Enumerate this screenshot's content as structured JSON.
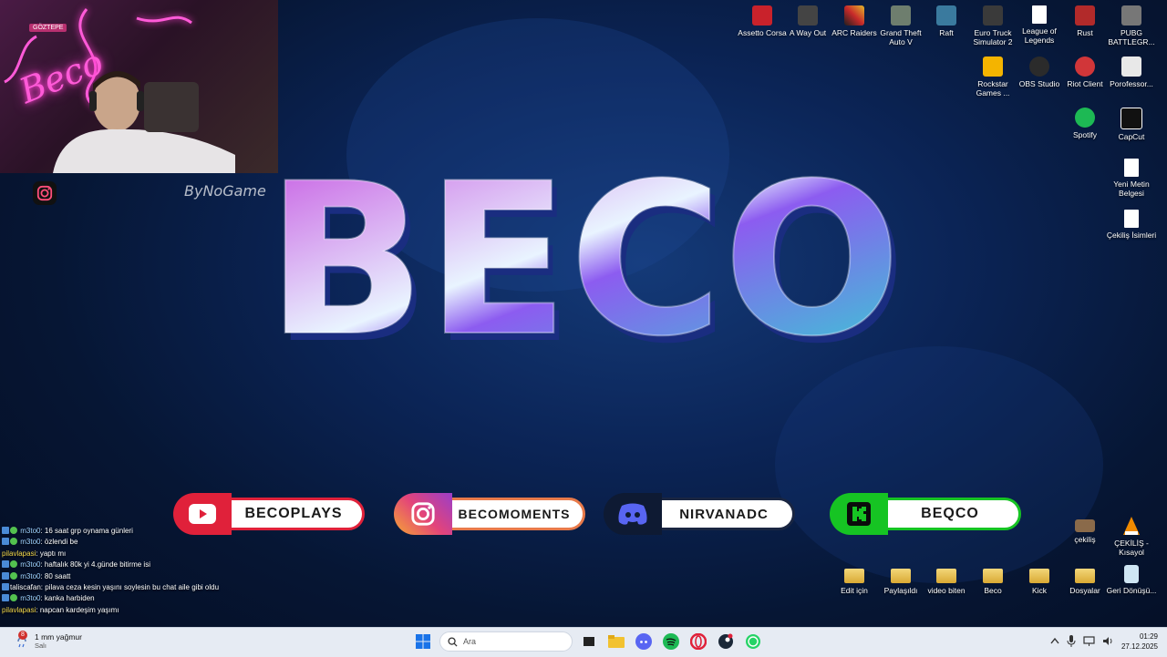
{
  "webcam": {
    "sign_text": "GÖZTEPE",
    "neon_text": "Beco"
  },
  "watermark": "ByNoGame",
  "logo_text": "BECO",
  "socials": [
    {
      "platform": "youtube-icon",
      "handle": "BECOPLAYS",
      "color": "#e0213a"
    },
    {
      "platform": "instagram-icon",
      "handle": "BECOMOMENTS",
      "color": "#e3447a"
    },
    {
      "platform": "discord-icon",
      "handle": "NIRVANADC",
      "color": "#5865f2"
    },
    {
      "platform": "kick-icon",
      "handle": "BEQCO",
      "color": "#16c423"
    }
  ],
  "desktop_icons": [
    {
      "label": "Assetto Corsa",
      "icon": "assetto-corsa-icon",
      "color": "#c9222b"
    },
    {
      "label": "A Way Out",
      "icon": "a-way-out-icon",
      "color": "#444444"
    },
    {
      "label": "ARC Raiders",
      "icon": "arc-raiders-icon",
      "color": "#1f1f1f"
    },
    {
      "label": "Grand Theft Auto V",
      "icon": "gta-v-icon",
      "color": "#6e7e6e"
    },
    {
      "label": "Raft",
      "icon": "raft-icon",
      "color": "#3a7a9e"
    },
    {
      "label": "Euro Truck Simulator 2",
      "icon": "ets2-icon",
      "color": "#3a3a3a"
    },
    {
      "label": "League of Legends",
      "icon": "lol-doc-icon",
      "color": "#ffffff"
    },
    {
      "label": "Rust",
      "icon": "rust-icon",
      "color": "#b22a2a"
    },
    {
      "label": "PUBG BATTLEGR...",
      "icon": "pubg-icon",
      "color": "#777777"
    },
    {
      "label": "Rockstar Games ...",
      "icon": "rockstar-icon",
      "color": "#f4b400"
    },
    {
      "label": "OBS Studio",
      "icon": "obs-icon",
      "color": "#2b2b2b"
    },
    {
      "label": "Riot Client",
      "icon": "riot-icon",
      "color": "#d13639"
    },
    {
      "label": "Porofessor...",
      "icon": "porofessor-icon",
      "color": "#e8e8e8"
    },
    {
      "label": "Spotify",
      "icon": "spotify-icon",
      "color": "#1db954"
    },
    {
      "label": "CapCut",
      "icon": "capcut-icon",
      "color": "#111111"
    },
    {
      "label": "Yeni Metin Belgesi",
      "icon": "text-document-icon",
      "color": "#ffffff"
    },
    {
      "label": "Çekiliş İsimleri",
      "icon": "text-document-icon",
      "color": "#ffffff"
    },
    {
      "label": "çekiliş",
      "icon": "image-file-icon",
      "color": "#8a6a4a"
    },
    {
      "label": "ÇEKİLİŞ - Kısayol",
      "icon": "vlc-icon",
      "color": "#f08a00"
    },
    {
      "label": "Edit için",
      "icon": "folder-icon",
      "color": "#e6b94a"
    },
    {
      "label": "Paylaşıldı",
      "icon": "folder-icon",
      "color": "#e6b94a"
    },
    {
      "label": "video biten",
      "icon": "folder-icon",
      "color": "#e6b94a"
    },
    {
      "label": "Beco",
      "icon": "folder-icon",
      "color": "#e6b94a"
    },
    {
      "label": "Kick",
      "icon": "folder-icon",
      "color": "#e6b94a"
    },
    {
      "label": "Dosyalar",
      "icon": "folder-icon",
      "color": "#e6b94a"
    },
    {
      "label": "Geri Dönüşü...",
      "icon": "recycle-bin-icon",
      "color": "#cfe6f4"
    }
  ],
  "chat": [
    {
      "user": "m3to0",
      "message": "16 saat grp oynama günleri",
      "badges": true
    },
    {
      "user": "m3to0",
      "message": "özlendi be",
      "badges": true
    },
    {
      "user": "pilavlapasi",
      "message": "yaptı mı",
      "badges": false
    },
    {
      "user": "m3to0",
      "message": "haftalık 80k yi 4.günde bitirme isi",
      "badges": true
    },
    {
      "user": "m3to0",
      "message": "80 saatt",
      "badges": true
    },
    {
      "user": "taliscafan",
      "message": "pilava ceza kesin yaşını soylesin bu chat aile gibi oldu",
      "badges": false
    },
    {
      "user": "m3to0",
      "message": "kanka harbiden",
      "badges": true
    },
    {
      "user": "pilavlapasi",
      "message": "napcan kardeşim yaşımı",
      "badges": false
    }
  ],
  "taskbar": {
    "weather_badge": "8",
    "weather_line1": "1 mm yağmur",
    "weather_line2": "Salı",
    "search_placeholder": "Ara",
    "time": "01:29",
    "date": "27.12.2025"
  }
}
